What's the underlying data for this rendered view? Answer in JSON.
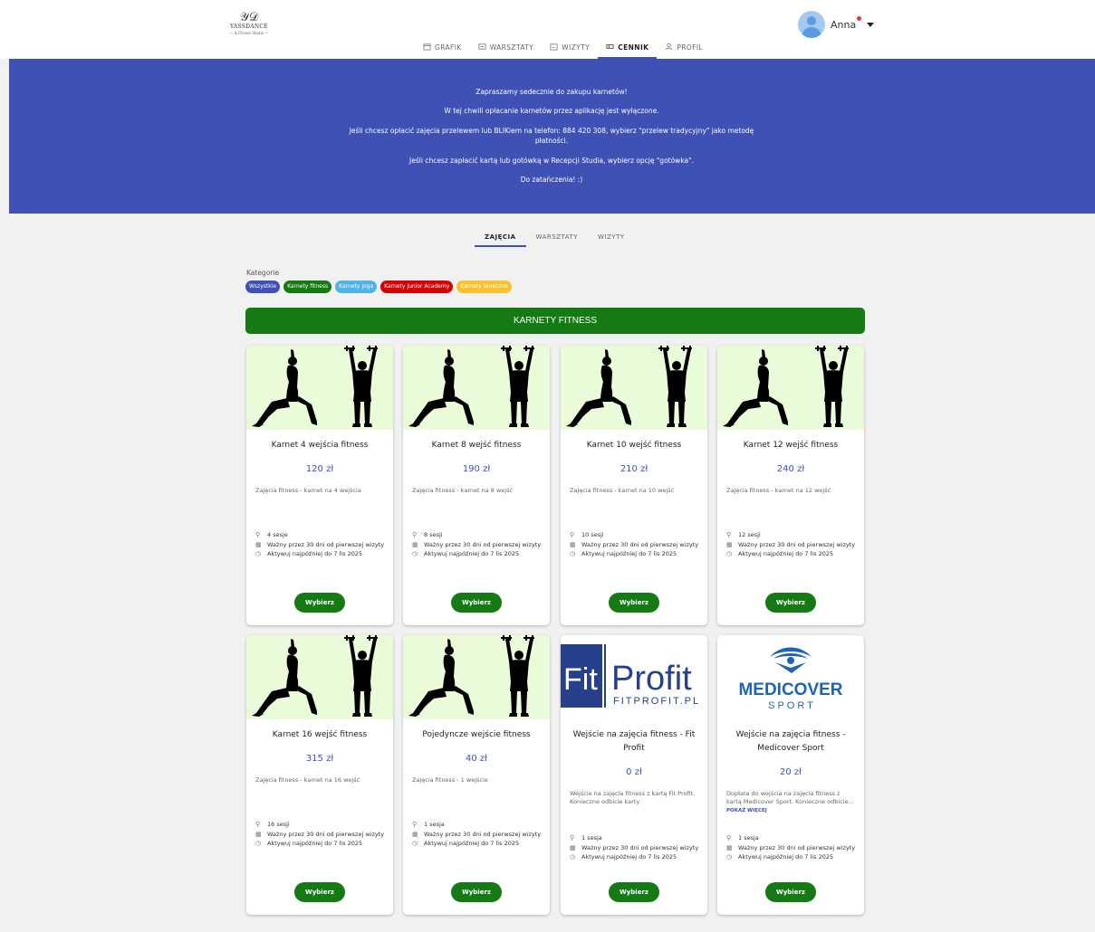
{
  "logo": {
    "mark": "𝒴𝒟",
    "name": "YASSDANCE",
    "sub": "— & Fitness Studio —"
  },
  "nav": [
    {
      "label": "GRAFIK",
      "icon": "calendar-icon"
    },
    {
      "label": "WARSZTATY",
      "icon": "workshop-icon"
    },
    {
      "label": "WIZYTY",
      "icon": "visits-icon"
    },
    {
      "label": "CENNIK",
      "icon": "ticket-icon",
      "active": true
    },
    {
      "label": "PROFIL",
      "icon": "person-icon"
    }
  ],
  "user": {
    "name": "Anna"
  },
  "banner": {
    "lines": [
      "Zapraszamy sedecznie do zakupu karnetów!",
      "W tej chwili opłacanie karnetów przez aplikację jest wyłączone.",
      "Jeśli chcesz opłacić zajęcia przelewem lub BLIKiem na telefon: 884 420 308, wybierz \"przelew tradycyjny\" jako metodę płatności.",
      "Jeśli chcesz zapłacić kartą lub gotówką w Recepcji Studia, wybierz opcję \"gotówka\".",
      "Do zatańczenia! :)"
    ]
  },
  "tabs": [
    {
      "label": "ZAJĘCIA",
      "active": true
    },
    {
      "label": "WARSZTATY"
    },
    {
      "label": "WIZYTY"
    }
  ],
  "categories": {
    "label": "Kategorie",
    "chips": [
      {
        "label": "Wszystkie",
        "color": "#3f51b5"
      },
      {
        "label": "Karnety fitness",
        "color": "#157a13"
      },
      {
        "label": "Karnety joga",
        "color": "#4fb3e8"
      },
      {
        "label": "Karnety Junior Academy",
        "color": "#d50000"
      },
      {
        "label": "Karnety taneczne",
        "color": "#fbc02d"
      }
    ]
  },
  "section": {
    "title": "KARNETY FITNESS",
    "color": "#157a13"
  },
  "common": {
    "valid": "Ważny przez 30 dni od pierwszej wizyty",
    "activate": "Aktywuj najpóźniej do 7 lis 2025",
    "button": "Wybierz",
    "more": "POKAŻ WIĘCEJ"
  },
  "cards": [
    {
      "image": "fitness",
      "title": "Karnet 4 wejścia fitness",
      "price": "120 zł",
      "desc": "Zajęcia fitness - karnet na 4 wejścia",
      "sessions": "4 sesje"
    },
    {
      "image": "fitness",
      "title": "Karnet 8 wejść fitness",
      "price": "190 zł",
      "desc": "Zajęcia fitness - karnet na 8 wejść",
      "sessions": "8 sesji"
    },
    {
      "image": "fitness",
      "title": "Karnet 10 wejść fitness",
      "price": "210 zł",
      "desc": "Zajęcia fitness - karnet na 10 wejść",
      "sessions": "10 sesji"
    },
    {
      "image": "fitness",
      "title": "Karnet 12 wejść fitness",
      "price": "240 zł",
      "desc": "Zajęcia fitness - karnet na 12 wejść",
      "sessions": "12 sesji"
    },
    {
      "image": "fitness",
      "title": "Karnet 16 wejść fitness",
      "price": "315 zł",
      "desc": "Zajęcia fitness - karnet na 16 wejść",
      "sessions": "16 sesji"
    },
    {
      "image": "fitness",
      "title": "Pojedyncze wejście fitness",
      "price": "40 zł",
      "desc": "Zajęcia fitness - 1 wejście",
      "sessions": "1 sesja"
    },
    {
      "image": "fitprofit",
      "title": "Wejście na zajęcia fitness - Fit Profit",
      "price": "0 zł",
      "desc": "Wejście na zajęcia fitness z kartą Fit Profit. Konieczne odbicie karty",
      "sessions": "1 sesja",
      "logo": {
        "word1": "Fit",
        "word2": "Profit",
        "sub": "FITPROFIT.PL"
      }
    },
    {
      "image": "medicover",
      "title": "Wejście na zajęcia fitness - Medicover Sport",
      "price": "20 zł",
      "desc": "Dopłata do wejścia na zajęcia fitness z kartą Medicover Sport. Konieczne odbicie...",
      "sessions": "1 sesja",
      "more": true,
      "logo": {
        "word1": "MEDICOVER",
        "word2": "S P O R T"
      }
    }
  ]
}
